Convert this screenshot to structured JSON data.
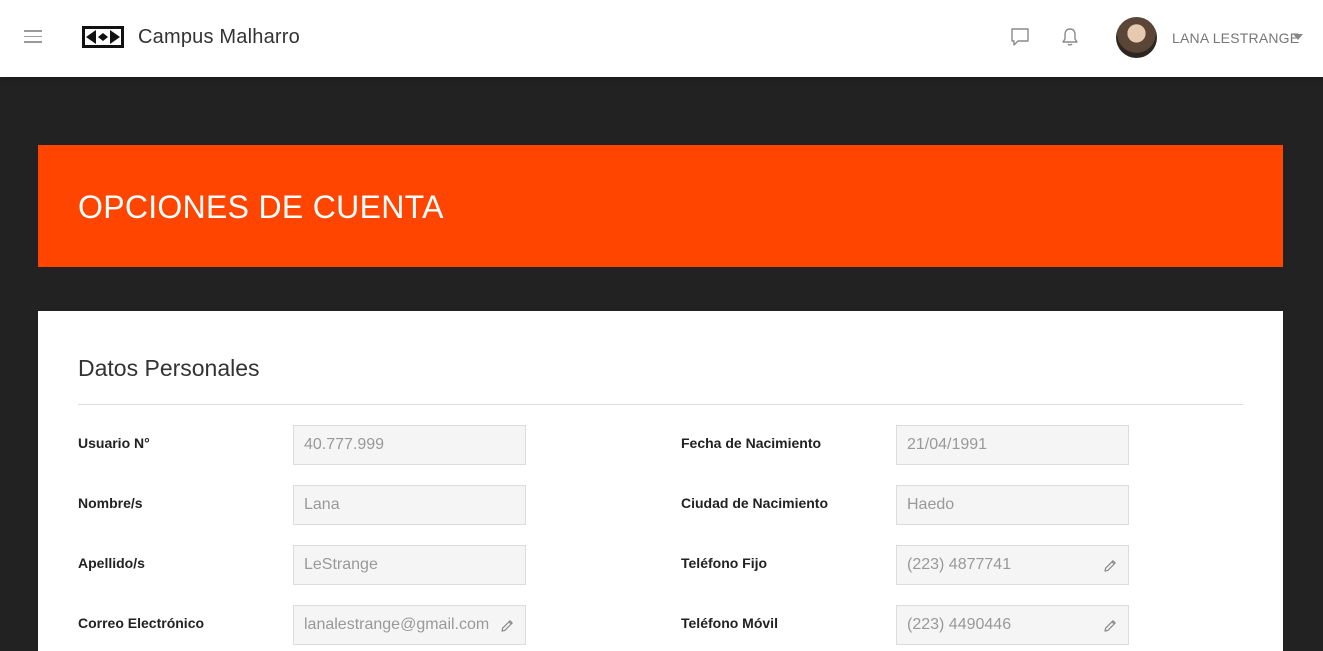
{
  "topbar": {
    "brand": "Campus Malharro",
    "username": "LANA LESTRANGE",
    "icons": [
      "menu-icon",
      "logo",
      "chat-icon",
      "bell-icon",
      "caret-down-icon"
    ]
  },
  "banner": {
    "title": "OPCIONES DE CUENTA",
    "color": "#ff4500"
  },
  "personal": {
    "title": "Datos Personales",
    "fields": {
      "usuario": {
        "label": "Usuario N°",
        "value": "40.777.999"
      },
      "nombre": {
        "label": "Nombre/s",
        "value": "Lana"
      },
      "apellido": {
        "label": "Apellido/s",
        "value": "LeStrange"
      },
      "correo": {
        "label": "Correo Electrónico",
        "value": "lanalestrange@gmail.com"
      },
      "fecha": {
        "label": "Fecha de Nacimiento",
        "value": "21/04/1991"
      },
      "ciudad": {
        "label": "Ciudad de Nacimiento",
        "value": "Haedo"
      },
      "telfijo": {
        "label": "Teléfono Fijo",
        "value": "(223) 4877741"
      },
      "telmovil": {
        "label": "Teléfono Móvil",
        "value": "(223) 4490446"
      }
    }
  }
}
